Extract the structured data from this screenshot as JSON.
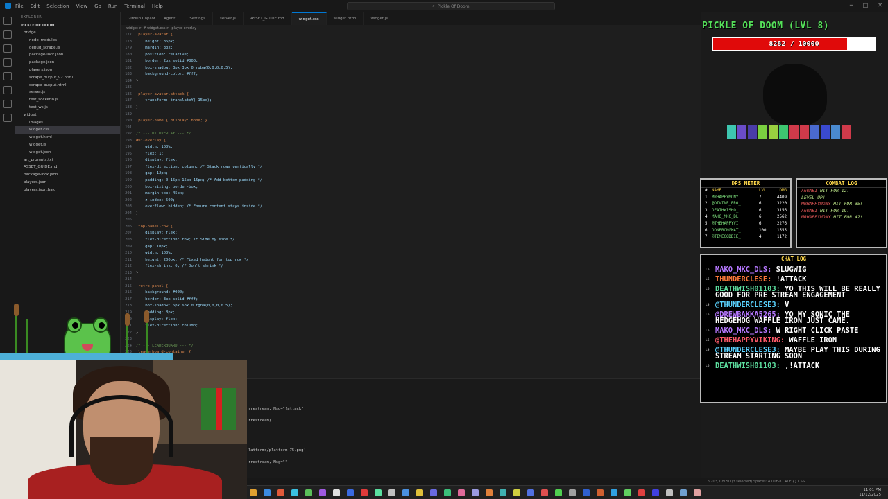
{
  "menu": [
    "File",
    "Edit",
    "Selection",
    "View",
    "Go",
    "Run",
    "Terminal",
    "Help"
  ],
  "search_text": "Pickle Of Doom",
  "explorer": {
    "header": "EXPLORER",
    "root": "PICKLE OF DOOM",
    "items": [
      {
        "label": "bridge",
        "indent": 1
      },
      {
        "label": "node_modules",
        "indent": 2
      },
      {
        "label": "debug_scrape.js",
        "indent": 2
      },
      {
        "label": "package-lock.json",
        "indent": 2
      },
      {
        "label": "package.json",
        "indent": 2
      },
      {
        "label": "players.json",
        "indent": 2
      },
      {
        "label": "scrape_output_v2.html",
        "indent": 2
      },
      {
        "label": "scrape_output.html",
        "indent": 2
      },
      {
        "label": "server.js",
        "indent": 2
      },
      {
        "label": "test_socketio.js",
        "indent": 2
      },
      {
        "label": "test_ws.js",
        "indent": 2
      },
      {
        "label": "widget",
        "indent": 1
      },
      {
        "label": "images",
        "indent": 2
      },
      {
        "label": "widget.css",
        "indent": 2,
        "selected": true
      },
      {
        "label": "widget.html",
        "indent": 2
      },
      {
        "label": "widget.js",
        "indent": 2
      },
      {
        "label": "widget.json",
        "indent": 2
      },
      {
        "label": "art_prompts.txt",
        "indent": 1
      },
      {
        "label": "ASSET_GUIDE.md",
        "indent": 1
      },
      {
        "label": "package-lock.json",
        "indent": 1
      },
      {
        "label": "players.json",
        "indent": 1
      },
      {
        "label": "players.json.bak",
        "indent": 1
      }
    ]
  },
  "tabs": [
    {
      "label": "GitHub Copilot CLI Agent"
    },
    {
      "label": "Settings"
    },
    {
      "label": "server.js"
    },
    {
      "label": "ASSET_GUIDE.md"
    },
    {
      "label": "widget.css",
      "active": true
    },
    {
      "label": "widget.html"
    },
    {
      "label": "widget.js"
    }
  ],
  "breadcrumb": "widget > # widget.css > .player-overlay",
  "code": [
    {
      "n": "177",
      "t": ".player-avatar {",
      "k": "sel"
    },
    {
      "n": "178",
      "t": "    height: 36px;",
      "k": "prop"
    },
    {
      "n": "179",
      "t": "    margin: 3px;",
      "k": "prop"
    },
    {
      "n": "180",
      "t": "    position: relative;",
      "k": "prop"
    },
    {
      "n": "181",
      "t": "    border: 2px solid #000;",
      "k": "prop"
    },
    {
      "n": "182",
      "t": "    box-shadow: 3px 3px 0 rgba(0,0,0,0.5);",
      "k": "prop"
    },
    {
      "n": "183",
      "t": "    background-color: #fff;",
      "k": "prop"
    },
    {
      "n": "184",
      "t": "}",
      "k": ""
    },
    {
      "n": "185",
      "t": "",
      "k": ""
    },
    {
      "n": "186",
      "t": ".player-avatar.attack {",
      "k": "sel"
    },
    {
      "n": "187",
      "t": "    transform: translateY(-15px);",
      "k": "prop"
    },
    {
      "n": "188",
      "t": "}",
      "k": ""
    },
    {
      "n": "189",
      "t": "",
      "k": ""
    },
    {
      "n": "190",
      "t": ".player-name { display: none; }",
      "k": "sel"
    },
    {
      "n": "191",
      "t": "",
      "k": ""
    },
    {
      "n": "192",
      "t": "/* --- UI OVERLAY --- */",
      "k": "cmt"
    },
    {
      "n": "193",
      "t": "#ui-overlay {",
      "k": "sel"
    },
    {
      "n": "194",
      "t": "    width: 100%;",
      "k": "prop"
    },
    {
      "n": "195",
      "t": "    flex: 1;",
      "k": "prop"
    },
    {
      "n": "196",
      "t": "    display: flex;",
      "k": "prop"
    },
    {
      "n": "197",
      "t": "    flex-direction: column; /* Stack rows vertically */",
      "k": "prop"
    },
    {
      "n": "198",
      "t": "    gap: 12px;",
      "k": "prop"
    },
    {
      "n": "199",
      "t": "    padding: 0 15px 15px 15px; /* Add bottom padding */",
      "k": "prop"
    },
    {
      "n": "200",
      "t": "    box-sizing: border-box;",
      "k": "prop"
    },
    {
      "n": "201",
      "t": "    margin-top: 45px;",
      "k": "prop"
    },
    {
      "n": "202",
      "t": "    z-index: 500;",
      "k": "prop"
    },
    {
      "n": "203",
      "t": "    overflow: hidden; /* Ensure content stays inside */",
      "k": "prop"
    },
    {
      "n": "204",
      "t": "}",
      "k": ""
    },
    {
      "n": "205",
      "t": "",
      "k": ""
    },
    {
      "n": "206",
      "t": ".top-panel-row {",
      "k": "sel"
    },
    {
      "n": "207",
      "t": "    display: flex;",
      "k": "prop"
    },
    {
      "n": "208",
      "t": "    flex-direction: row; /* Side by side */",
      "k": "prop"
    },
    {
      "n": "209",
      "t": "    gap: 10px;",
      "k": "prop"
    },
    {
      "n": "210",
      "t": "    width: 100%;",
      "k": "prop"
    },
    {
      "n": "211",
      "t": "    height: 200px; /* Fixed height for top row */",
      "k": "prop"
    },
    {
      "n": "212",
      "t": "    flex-shrink: 0; /* Don't shrink */",
      "k": "prop"
    },
    {
      "n": "213",
      "t": "}",
      "k": ""
    },
    {
      "n": "214",
      "t": "",
      "k": ""
    },
    {
      "n": "215",
      "t": ".retro-panel {",
      "k": "sel"
    },
    {
      "n": "216",
      "t": "    background: #000;",
      "k": "prop"
    },
    {
      "n": "217",
      "t": "    border: 3px solid #fff;",
      "k": "prop"
    },
    {
      "n": "218",
      "t": "    box-shadow: 6px 6px 0 rgba(0,0,0,0.5);",
      "k": "prop"
    },
    {
      "n": "219",
      "t": "    padding: 8px;",
      "k": "prop"
    },
    {
      "n": "220",
      "t": "    display: flex;",
      "k": "prop"
    },
    {
      "n": "221",
      "t": "    flex-direction: column;",
      "k": "prop"
    },
    {
      "n": "222",
      "t": "}",
      "k": ""
    },
    {
      "n": "223",
      "t": "",
      "k": ""
    },
    {
      "n": "224",
      "t": "/* --- LEADERBOARD --- */",
      "k": "cmt"
    },
    {
      "n": "225",
      "t": ".leaderboard-container {",
      "k": "sel"
    }
  ],
  "terminal_lines": [
    "rrestream, Msg=\"!attack\"",
    "rrestream)",
    "latforms/platform-75.png'",
    "rrestream, Msg=\"\""
  ],
  "status": "Ln 203, Col 50 (3 selected)   Spaces: 4   UTF-8   CRLF   {} CSS",
  "clock": {
    "time": "11:01 PM",
    "date": "11/12/2025"
  },
  "overlay": {
    "boss_title": "PICKLE OF DOOM (LVL 8)",
    "hp_text": "8282 / 10000",
    "hp_current": 8282,
    "hp_max": 10000,
    "hp_color": "#e00a0a",
    "block_colors": [
      "#3ec6b0",
      "#6a4cc8",
      "#4a3ca8",
      "#7ad040",
      "#9ad040",
      "#3ec670",
      "#d03a4a",
      "#d03a4a",
      "#4a6ad0",
      "#3a4ad0",
      "#4a8ad0",
      "#d03a4a"
    ]
  },
  "dps": {
    "title": "DPS METER",
    "headers": {
      "rank": "#",
      "name": "NAME",
      "lvl": "LVL",
      "dmg": "DMG"
    },
    "rows": [
      {
        "rank": "1",
        "name": "MRHAPPYMONY",
        "lvl": "7",
        "dmg": "4409"
      },
      {
        "rank": "2",
        "name": "@DIVINE_PRO_",
        "lvl": "6",
        "dmg": "3220"
      },
      {
        "rank": "3",
        "name": "DEATHWISHO_",
        "lvl": "6",
        "dmg": "3156"
      },
      {
        "rank": "4",
        "name": "MAKO_MKC_DL",
        "lvl": "6",
        "dmg": "2562"
      },
      {
        "rank": "5",
        "name": "@THEHAPPYVI",
        "lvl": "6",
        "dmg": "2276"
      },
      {
        "rank": "6",
        "name": "DONPBONGMAT_",
        "lvl": "100",
        "dmg": "1555"
      },
      {
        "rank": "7",
        "name": "@TIMEGODDIE_",
        "lvl": "4",
        "dmg": "1172"
      }
    ]
  },
  "combat": {
    "title": "COMBAT LOG",
    "entries": [
      {
        "name": "AGOABI",
        "text": "HIT FOR 12!"
      },
      {
        "name": "",
        "text": "LEVEL UP!"
      },
      {
        "name": "MRHAPPYMONY",
        "text": "HIT FOR 35!"
      },
      {
        "name": "AGOABI",
        "text": "HIT FOR 19!"
      },
      {
        "name": "MRHAPPYMONY",
        "text": "HIT FOR 42!"
      }
    ]
  },
  "chat": {
    "title": "CHAT LOG",
    "messages": [
      {
        "lvl": "L6",
        "user": "MAKO_MKC_DLS:",
        "msg": " SLUGWIG",
        "color": "#b678ff"
      },
      {
        "lvl": "L6",
        "user": "THUNDERCLESE:",
        "msg": " !ATTACK",
        "color": "#ff7a3a"
      },
      {
        "lvl": "L6",
        "user": "DEATHWISH01103:",
        "msg": " YO THIS WILL BE REALLY GOOD FOR PRE STREAM ENGAGEMENT",
        "color": "#5de0a0"
      },
      {
        "lvl": "L4",
        "user": "@THUNDERCLESE3:",
        "msg": " V",
        "color": "#5ad3ff"
      },
      {
        "lvl": "L6",
        "user": "@DREWBAKKA5265:",
        "msg": " YO MY SONIC THE HEDGEHOG WAFFLE IRON JUST CAME.",
        "color": "#b678ff"
      },
      {
        "lvl": "L6",
        "user": "MAKO_MKC_DLS:",
        "msg": " W RIGHT CLICK PASTE",
        "color": "#b678ff"
      },
      {
        "lvl": "L6",
        "user": "@THEHAPPYVIKING:",
        "msg": " WAFFLE IRON",
        "color": "#ff5a6a"
      },
      {
        "lvl": "L4",
        "user": "@THUNDERCLESE3:",
        "msg": " MAYBE PLAY THIS DURING STREAM STARTING SOON",
        "color": "#5ad3ff"
      },
      {
        "lvl": "L6",
        "user": "DEATHWISH01103:",
        "msg": " ,!ATTACK",
        "color": "#5de0a0"
      }
    ]
  },
  "taskbar_icons": [
    "#e0a030",
    "#3a8ae0",
    "#e05a3a",
    "#3ac0e0",
    "#5ac05a",
    "#a05ae0",
    "#e0e0e0",
    "#3a6ae0",
    "#e03a3a",
    "#5ae0a0",
    "#c0c0c0",
    "#4a90e0",
    "#e0c03a",
    "#6a6ae0",
    "#3ac07a",
    "#e06a9a",
    "#9a9ae0",
    "#e0803a",
    "#40b0b0",
    "#d0d040",
    "#5070e0",
    "#e05050",
    "#50d050",
    "#a0a0a0",
    "#3060d0",
    "#d06030",
    "#30a0e0",
    "#60d060",
    "#e04040",
    "#4040e0",
    "#c0c0c0",
    "#70a0d0",
    "#e0a0a0"
  ]
}
